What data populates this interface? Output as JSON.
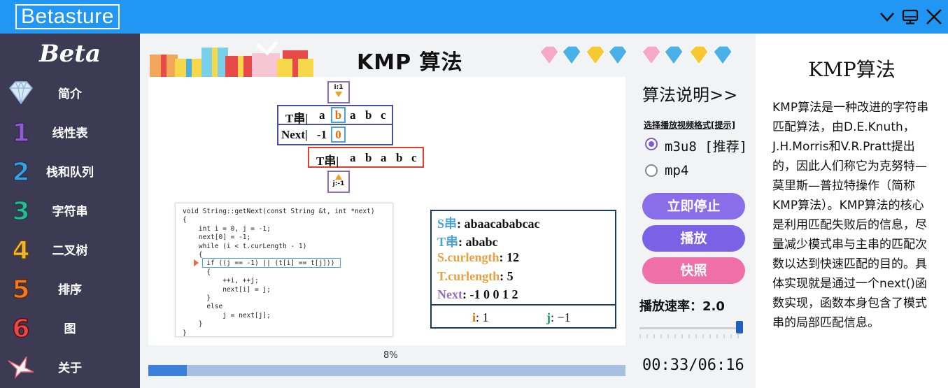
{
  "app": {
    "title": "Betasture"
  },
  "window_controls": {
    "icons": [
      "chevron-down-icon",
      "monitor-icon",
      "close-icon"
    ]
  },
  "sidebar": {
    "logo": "Beta",
    "items": [
      {
        "label": "简介",
        "icon": "diamond-icon"
      },
      {
        "label": "线性表",
        "icon": "digit-1-icon"
      },
      {
        "label": "栈和队列",
        "icon": "digit-2-icon"
      },
      {
        "label": "字符串",
        "icon": "digit-3-icon"
      },
      {
        "label": "二叉树",
        "icon": "digit-4-icon"
      },
      {
        "label": "排序",
        "icon": "digit-5-icon"
      },
      {
        "label": "图",
        "icon": "digit-6-icon"
      },
      {
        "label": "关于",
        "icon": "paper-crane-icon"
      }
    ]
  },
  "main": {
    "title": "KMP  算法",
    "visual": {
      "i_pointer": "i:1",
      "j_pointer": "j:-1",
      "t_row": {
        "label": "T串|",
        "chars": [
          "a",
          "b",
          "a",
          "b",
          "c"
        ],
        "highlight_index": 1
      },
      "next_row": {
        "label": "Next|",
        "values": [
          "-1",
          "0"
        ],
        "highlight_index": 1
      },
      "pattern_row": {
        "label": "T串|",
        "chars": [
          "a",
          "b",
          "a",
          "b",
          "c"
        ]
      }
    },
    "code": "void String::getNext(const String &t, int *next)\n{\n    int i = 0, j = -1;\n    next[0] = -1;\n    while (i < t.curLength - 1)\n    {\n      if ((j == -1) || (t[i] == t[j]))\n      {\n          ++i, ++j;\n          next[i] = j;\n      }\n      else\n          j = next[j];\n    }\n}",
    "info": {
      "s_label": "S串",
      "s_value": "abaacababcac",
      "t_label": "T串",
      "t_value": "ababc",
      "s_len_label": "S.curlength",
      "s_len_value": "12",
      "t_len_label": "T.curlength",
      "t_len_value": "5",
      "next_label": "Next",
      "next_value": "-1 0 0 1 2",
      "i_label": "i",
      "i_value": "1",
      "j_label": "j",
      "j_value": "−1"
    },
    "progress": {
      "label": "8%",
      "fraction": 0.08
    }
  },
  "controls": {
    "algo_link": "算法说明>>",
    "format_label": "选择播放视频格式[提示]",
    "formats": [
      {
        "label": "m3u8 [推荐]",
        "selected": true
      },
      {
        "label": "mp4",
        "selected": false
      }
    ],
    "stop_button": "立即停止",
    "play_button": "播放",
    "snapshot_button": "快照",
    "speed_label": "播放速率：2.0",
    "speed_level": 1.0,
    "time": "00:33/06:16"
  },
  "description": {
    "title": "KMP算法",
    "text": "KMP算法是一种改进的字符串匹配算法，由D.E.Knuth，J.H.Morris和V.R.Pratt提出的，因此人们称它为克努特—莫里斯—普拉特操作（简称KMP算法）。KMP算法的核心是利用匹配失败后的信息，尽量减少模式串与主串的匹配次数以达到快速匹配的目的。具体实现就是通过一个next()函数实现，函数本身包含了模式串的局部匹配信息。"
  },
  "colors": {
    "titlebar": "#2196f3",
    "sidebar": "#3d3a54",
    "stop_button": "#8a6de9",
    "play_button": "#7b61e6",
    "snapshot_button": "#ef6fa8",
    "progress_fill": "#3b7fd9",
    "s_label": "#4aa3d8",
    "t_label": "#4aa3d8",
    "len_label": "#e8a040",
    "next_label": "#9b6fb5",
    "i_label": "#e86c00",
    "j_label": "#1a9a5a"
  }
}
